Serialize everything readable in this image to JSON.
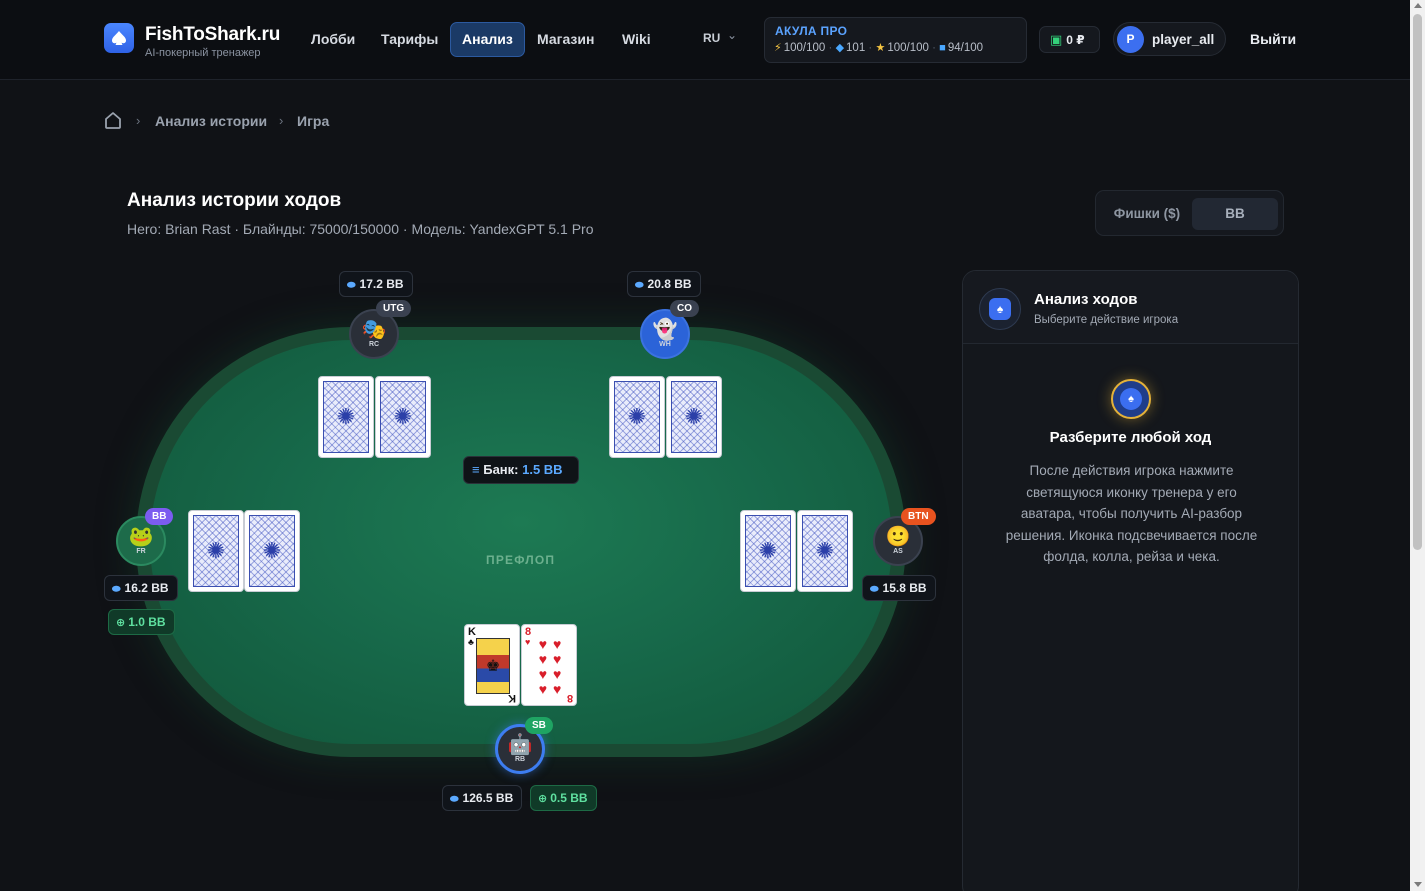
{
  "header": {
    "logo_title": "FishToShark.ru",
    "logo_subtitle": "AI-покерный тренажер",
    "nav": [
      {
        "label": "Лобби",
        "active": false
      },
      {
        "label": "Тарифы",
        "active": false
      },
      {
        "label": "Анализ",
        "active": true
      },
      {
        "label": "Магазин",
        "active": false
      },
      {
        "label": "Wiki",
        "active": false
      }
    ],
    "language": "RU",
    "plan": {
      "title": "АКУЛА ПРО",
      "stats": [
        {
          "icon": "lightning-icon",
          "value": "100/100"
        },
        {
          "icon": "diamond-icon",
          "value": "101"
        },
        {
          "icon": "star-icon",
          "value": "100/100"
        },
        {
          "icon": "gem-icon",
          "value": "94/100"
        }
      ]
    },
    "balance": "0 ₽",
    "user": {
      "initial": "P",
      "name": "player_all"
    },
    "logout": "Выйти"
  },
  "breadcrumb": [
    "Анализ истории",
    "Игра"
  ],
  "page": {
    "title": "Анализ истории ходов",
    "subtitle": "Hero: Brian Rast · Блайнды: 75000/150000 · Модель: YandexGPT 5.1 Pro"
  },
  "unit_toggle": {
    "options": [
      "Фишки ($)",
      "BB"
    ],
    "selected": "BB"
  },
  "table": {
    "pot_label": "Банк:",
    "pot_value": "1.5 BB",
    "street": "ПРЕФЛОП",
    "players": [
      {
        "position": "UTG",
        "initials": "RC",
        "stack": "17.2 BB",
        "badge_color": "#3a4150"
      },
      {
        "position": "CO",
        "initials": "WH",
        "stack": "20.8 BB",
        "badge_color": "#3a4150"
      },
      {
        "position": "BB",
        "initials": "FR",
        "stack": "16.2 BB",
        "bet": "1.0 BB",
        "badge_color": "#7b5cf0"
      },
      {
        "position": "BTN",
        "initials": "AS",
        "stack": "15.8 BB",
        "badge_color": "#e8531f"
      },
      {
        "position": "SB",
        "initials": "RB",
        "stack": "126.5 BB",
        "bet": "0.5 BB",
        "badge_color": "#1fa463",
        "hero": true
      }
    ],
    "hero_cards": [
      {
        "rank": "K",
        "suit": "♣"
      },
      {
        "rank": "8",
        "suit": "♥"
      }
    ]
  },
  "panel": {
    "title": "Анализ ходов",
    "subtitle": "Выберите действие игрока",
    "heading": "Разберите любой ход",
    "text": "После действия игрока нажмите светящуюся иконку тренера у его аватара, чтобы получить AI-разбор решения. Иконка подсвечивается после фолда, колла, рейза и чека."
  }
}
